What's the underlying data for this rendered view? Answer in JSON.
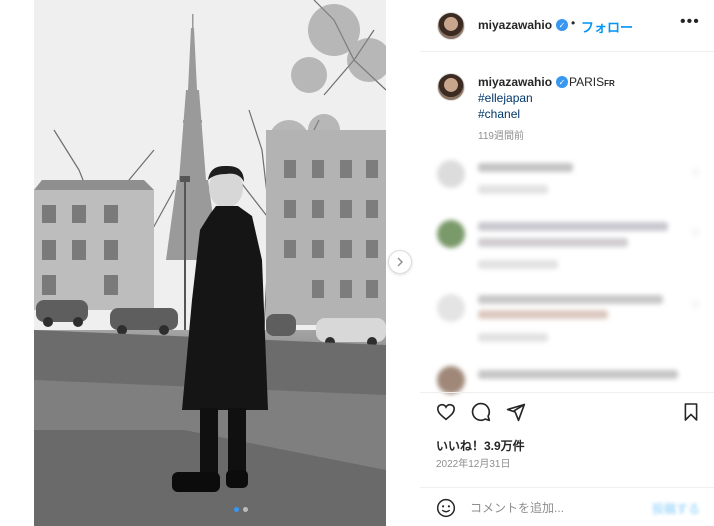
{
  "post": {
    "username": "miyazawahio",
    "follow_label": "フォロー",
    "separator": "•",
    "more_label": "•••",
    "caption": {
      "location": "PARIS",
      "location_suffix": "FR",
      "hashtags": [
        "#ellejapan",
        "#chanel"
      ],
      "age": "119週間前"
    },
    "likes": "いいね！3.9万件",
    "date": "2022年12月31日",
    "comment_placeholder": "コメントを追加...",
    "post_label": "投稿する"
  },
  "carousel": {
    "current_index": 1,
    "total": 2
  },
  "colors": {
    "accent": "#0095f6",
    "verified": "#3897f0",
    "text": "#262626",
    "muted": "#8e8e8e"
  },
  "icons": [
    "verified-badge-icon",
    "more-options-icon",
    "heart-icon",
    "comment-icon",
    "share-icon",
    "save-icon",
    "emoji-icon",
    "chevron-right-icon"
  ]
}
